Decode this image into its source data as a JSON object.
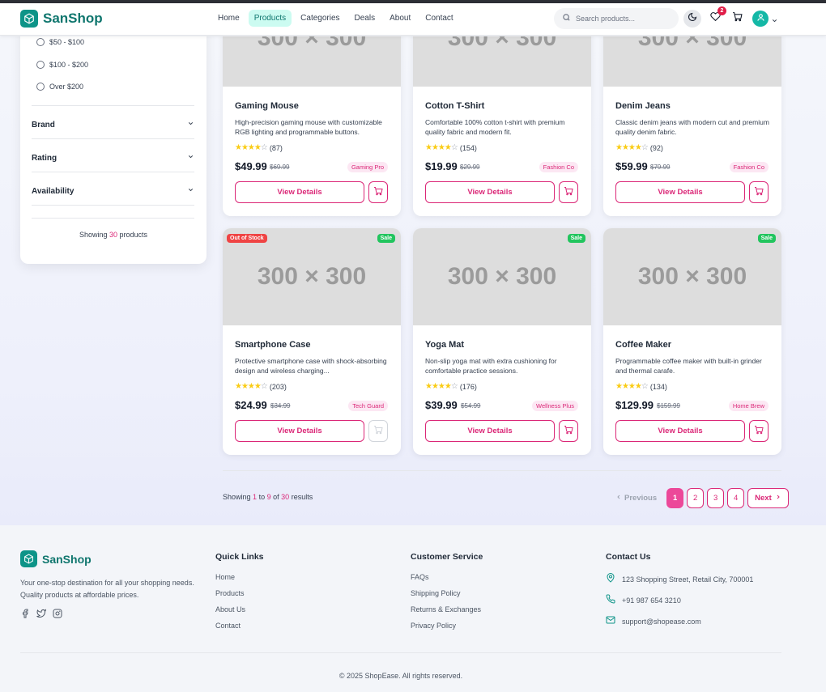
{
  "header": {
    "logo_text": "SanShop",
    "nav": [
      {
        "label": "Home",
        "active": false
      },
      {
        "label": "Products",
        "active": true
      },
      {
        "label": "Categories",
        "active": false
      },
      {
        "label": "Deals",
        "active": false
      },
      {
        "label": "About",
        "active": false
      },
      {
        "label": "Contact",
        "active": false
      }
    ],
    "search_placeholder": "Search products...",
    "wishlist_count": "2"
  },
  "filters": {
    "price_options": [
      "$50 - $100",
      "$100 - $200",
      "Over $200"
    ],
    "facets": [
      "Brand",
      "Rating",
      "Availability"
    ],
    "showing_prefix": "Showing",
    "showing_count": "30",
    "showing_suffix": "products"
  },
  "products": [
    {
      "name": "Gaming Mouse",
      "desc": "High-precision gaming mouse with customizable RGB lighting and programmable buttons.",
      "rating": 4,
      "reviews": "(87)",
      "price": "$49.99",
      "old_price": "$69.99",
      "brand": "Gaming Pro",
      "tags": [],
      "cart_enabled": true
    },
    {
      "name": "Cotton T-Shirt",
      "desc": "Comfortable 100% cotton t-shirt with premium quality fabric and modern fit.",
      "rating": 4,
      "reviews": "(154)",
      "price": "$19.99",
      "old_price": "$29.99",
      "brand": "Fashion Co",
      "tags": [],
      "cart_enabled": true
    },
    {
      "name": "Denim Jeans",
      "desc": "Classic denim jeans with modern cut and premium quality denim fabric.",
      "rating": 4,
      "reviews": "(92)",
      "price": "$59.99",
      "old_price": "$79.99",
      "brand": "Fashion Co",
      "tags": [],
      "cart_enabled": true
    },
    {
      "name": "Smartphone Case",
      "desc": "Protective smartphone case with shock-absorbing design and wireless charging...",
      "rating": 4,
      "reviews": "(203)",
      "price": "$24.99",
      "old_price": "$34.99",
      "brand": "Tech Guard",
      "tags": [
        "Out of Stock",
        "Sale"
      ],
      "cart_enabled": false
    },
    {
      "name": "Yoga Mat",
      "desc": "Non-slip yoga mat with extra cushioning for comfortable practice sessions.",
      "rating": 4,
      "reviews": "(176)",
      "price": "$39.99",
      "old_price": "$54.99",
      "brand": "Wellness Plus",
      "tags": [
        "Sale"
      ],
      "cart_enabled": true
    },
    {
      "name": "Coffee Maker",
      "desc": "Programmable coffee maker with built-in grinder and thermal carafe.",
      "rating": 4,
      "reviews": "(134)",
      "price": "$129.99",
      "old_price": "$159.99",
      "brand": "Home Brew",
      "tags": [
        "Sale"
      ],
      "cart_enabled": true
    }
  ],
  "placeholder_text": "300 × 300",
  "details_label": "View Details",
  "results": {
    "prefix": "Showing",
    "from": "1",
    "to_word": "to",
    "to": "9",
    "of_word": "of",
    "total": "30",
    "suffix": "results"
  },
  "pagination": {
    "prev": "Previous",
    "pages": [
      "1",
      "2",
      "3",
      "4"
    ],
    "current": "1",
    "next": "Next"
  },
  "footer": {
    "logo_text": "SanShop",
    "tagline": "Your one-stop destination for all your shopping needs. Quality products at affordable prices.",
    "quick_links_title": "Quick Links",
    "quick_links": [
      "Home",
      "Products",
      "About Us",
      "Contact"
    ],
    "customer_service_title": "Customer Service",
    "customer_service": [
      "FAQs",
      "Shipping Policy",
      "Returns & Exchanges",
      "Privacy Policy"
    ],
    "contact_title": "Contact Us",
    "address": "123 Shopping Street, Retail City, 700001",
    "phone": "+91 987 654 3210",
    "email": "support@shopease.com",
    "copyright": "© 2025 ShopEase. All rights reserved."
  },
  "colors": {
    "brand": "#0d9488",
    "accent": "#db2777",
    "sale": "#22c55e",
    "out_of_stock": "#ef4444",
    "star": "#facc15"
  }
}
